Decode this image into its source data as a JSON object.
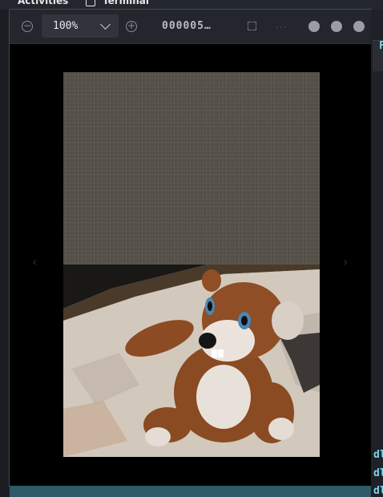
{
  "topbar": {
    "activities_label": "Activities",
    "terminal_label": "Terminal"
  },
  "viewer": {
    "zoom": {
      "value": "100%"
    },
    "filename": "000005…",
    "image": {
      "description_colors": {
        "upper_half": "#56524a",
        "lower_half": "#cfc5b9"
      }
    }
  },
  "side_panel": {
    "header_letter": "F",
    "terminal_lines": [
      "dl",
      "dl",
      "dl"
    ]
  }
}
